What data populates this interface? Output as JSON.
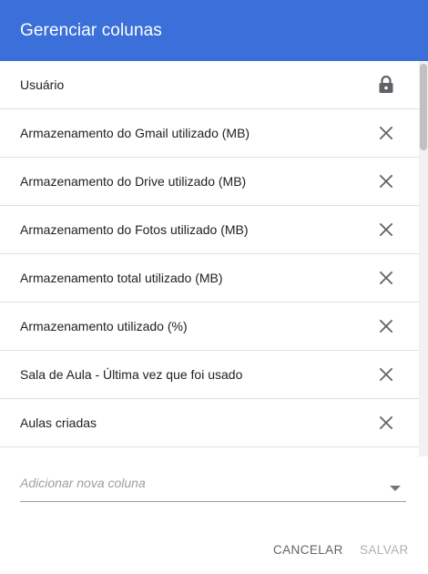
{
  "dialog": {
    "title": "Gerenciar colunas"
  },
  "columns": [
    {
      "label": "Usuário",
      "action_icon": "lock-icon"
    },
    {
      "label": "Armazenamento do Gmail utilizado (MB)",
      "action_icon": "close-icon"
    },
    {
      "label": "Armazenamento do Drive utilizado (MB)",
      "action_icon": "close-icon"
    },
    {
      "label": "Armazenamento do Fotos utilizado (MB)",
      "action_icon": "close-icon"
    },
    {
      "label": "Armazenamento total utilizado (MB)",
      "action_icon": "close-icon"
    },
    {
      "label": "Armazenamento utilizado (%)",
      "action_icon": "close-icon"
    },
    {
      "label": "Sala de Aula - Última vez que foi usado",
      "action_icon": "close-icon"
    },
    {
      "label": "Aulas criadas",
      "action_icon": "close-icon"
    }
  ],
  "add_column": {
    "placeholder": "Adicionar nova coluna",
    "icon": "dropdown-arrow-icon"
  },
  "footer": {
    "cancel_label": "CANCELAR",
    "save_label": "SALVAR"
  },
  "colors": {
    "header_bg": "#3b6fd9",
    "header_text": "#ffffff",
    "row_text": "#212121",
    "divider": "#e0e0e0",
    "icon": "#5f6368",
    "save_disabled": "#b0b0b0"
  }
}
